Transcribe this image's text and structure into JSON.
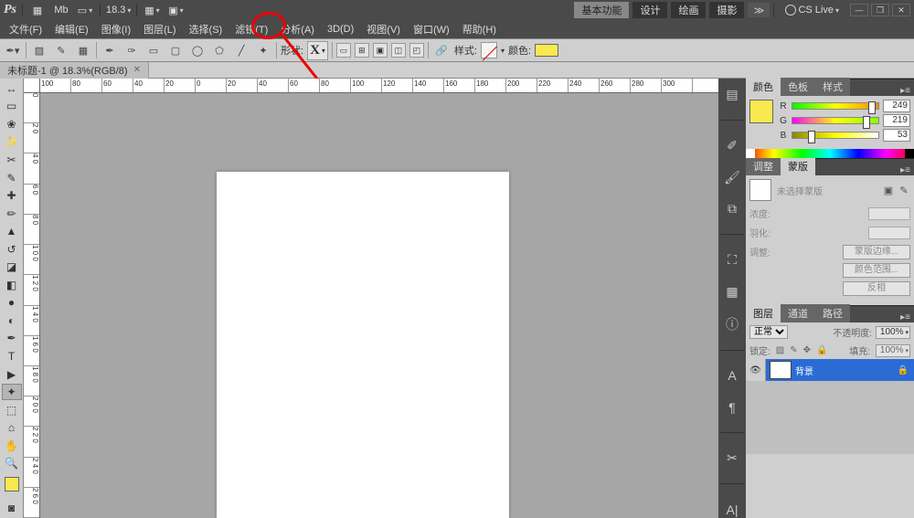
{
  "titlebar": {
    "zoom": "18.3",
    "workspaces": [
      "基本功能",
      "设计",
      "绘画",
      "摄影"
    ],
    "active_workspace": 0,
    "cslive": "CS Live"
  },
  "menus": [
    "文件(F)",
    "编辑(E)",
    "图像(I)",
    "图层(L)",
    "选择(S)",
    "滤镜(T)",
    "分析(A)",
    "3D(D)",
    "视图(V)",
    "窗口(W)",
    "帮助(H)"
  ],
  "options": {
    "shape_label": "形状:",
    "shape_value": "X",
    "style_label": "样式:",
    "color_label": "颜色:",
    "color_value": "#f9e94e"
  },
  "doc_tab": "未标题-1 @ 18.3%(RGB/8)",
  "ruler_h": [
    "100",
    "80",
    "60",
    "40",
    "20",
    "0",
    "20",
    "40",
    "60",
    "80",
    "100",
    "120",
    "140",
    "160",
    "180",
    "200",
    "220",
    "240",
    "260",
    "280",
    "300"
  ],
  "ruler_v": [
    "0",
    "2 0",
    "4 0",
    "6 0",
    "8 0",
    "1 0 0",
    "1 2 0",
    "1 4 0",
    "1 6 0",
    "1 8 0",
    "2 0 0",
    "2 2 0",
    "2 4 0",
    "2 6 0"
  ],
  "panels": {
    "color": {
      "tabs": [
        "颜色",
        "色板",
        "样式"
      ],
      "r": 249,
      "g": 219,
      "b": 53
    },
    "mask": {
      "tabs": [
        "调整",
        "蒙版"
      ],
      "none": "未选择蒙版",
      "density": "浓度:",
      "feather": "羽化:",
      "adjust": "调整:",
      "edge_btn": "蒙版边缘...",
      "range_btn": "颜色范围...",
      "invert_btn": "反相"
    },
    "layers": {
      "tabs": [
        "图层",
        "通道",
        "路径"
      ],
      "blend": "正常",
      "opacity_lbl": "不透明度:",
      "opacity": "100%",
      "lock_lbl": "锁定:",
      "fill_lbl": "填充:",
      "fill": "100%",
      "layer_name": "背景"
    }
  }
}
